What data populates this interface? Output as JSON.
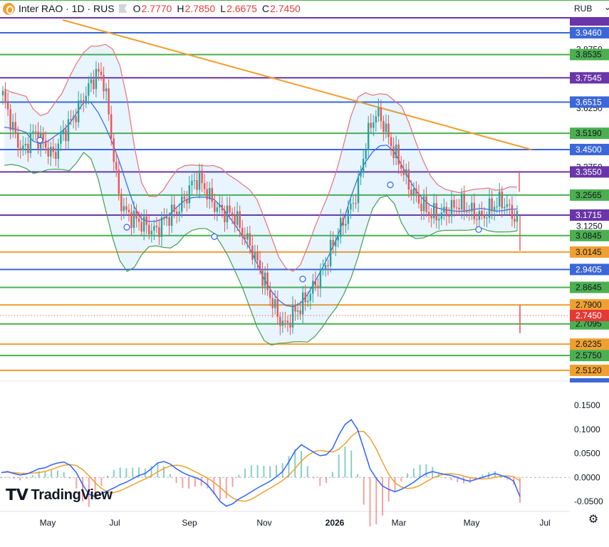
{
  "header": {
    "symbol": "Inter RAO · 1D · RUS",
    "o_label": "O",
    "o_value": "2.7770",
    "h_label": "H",
    "h_value": "2.7850",
    "l_label": "L",
    "l_value": "2.6675",
    "c_label": "C",
    "c_value": "2.7450"
  },
  "currency": "RUB",
  "brand": "TradingView",
  "chart_data": {
    "type": "line",
    "price_axis": {
      "min": 2.45,
      "max": 4.0,
      "tick_labels": [
        "3.8750",
        "3.6250",
        "3.3750",
        "3.1250"
      ]
    },
    "time_axis": {
      "labels": [
        "May",
        "Jul",
        "Sep",
        "Nov",
        "2026",
        "Mar",
        "May",
        "Jul"
      ],
      "bold": [
        "2026"
      ]
    },
    "levels": [
      {
        "price": 3.946,
        "label": "3.9460",
        "color": "#3c67d8"
      },
      {
        "price": 3.8535,
        "label": "3.8535",
        "color": "#4caf50"
      },
      {
        "price": 3.7545,
        "label": "3.7545",
        "color": "#6a35a8"
      },
      {
        "price": 3.6515,
        "label": "3.6515",
        "color": "#3c67d8"
      },
      {
        "price": 3.519,
        "label": "3.5190",
        "color": "#4caf50"
      },
      {
        "price": 3.45,
        "label": "3.4500",
        "color": "#3c67d8"
      },
      {
        "price": 3.355,
        "label": "3.3550",
        "color": "#6a35a8"
      },
      {
        "price": 3.2565,
        "label": "3.2565",
        "color": "#4caf50"
      },
      {
        "price": 3.1715,
        "label": "3.1715",
        "color": "#6a35a8"
      },
      {
        "price": 3.0845,
        "label": "3.0845",
        "color": "#4caf50"
      },
      {
        "price": 3.0145,
        "label": "3.0145",
        "color": "#f0a030"
      },
      {
        "price": 2.9405,
        "label": "2.9405",
        "color": "#3c67d8"
      },
      {
        "price": 2.8645,
        "label": "2.8645",
        "color": "#4caf50"
      },
      {
        "price": 2.79,
        "label": "2.7900",
        "color": "#f0a030"
      },
      {
        "price": 2.7095,
        "label": "2.7095",
        "color": "#4caf50"
      },
      {
        "price": 2.6235,
        "label": "2.6235",
        "color": "#f0a030"
      },
      {
        "price": 2.575,
        "label": "2.5750",
        "color": "#4caf50"
      },
      {
        "price": 2.512,
        "label": "2.5120",
        "color": "#f0a030"
      }
    ],
    "last_price": {
      "price": 2.745,
      "label": "2.7450",
      "color": "#e53935"
    },
    "trendline_color": "#f0a030",
    "price_series": [
      3.68,
      3.58,
      3.48,
      3.44,
      3.52,
      3.5,
      3.46,
      3.42,
      3.5,
      3.55,
      3.6,
      3.66,
      3.72,
      3.78,
      3.74,
      3.5,
      3.25,
      3.18,
      3.16,
      3.14,
      3.12,
      3.1,
      3.14,
      3.17,
      3.19,
      3.23,
      3.3,
      3.33,
      3.28,
      3.22,
      3.19,
      3.18,
      3.17,
      3.1,
      3.05,
      2.98,
      2.9,
      2.82,
      2.74,
      2.7,
      2.75,
      2.78,
      2.82,
      2.87,
      2.92,
      3.0,
      3.08,
      3.14,
      3.2,
      3.28,
      3.46,
      3.58,
      3.6,
      3.52,
      3.44,
      3.38,
      3.3,
      3.25,
      3.21,
      3.18,
      3.17,
      3.18,
      3.2,
      3.22,
      3.2,
      3.18,
      3.16,
      3.19,
      3.22,
      3.23,
      3.19,
      3.15
    ],
    "oscillator": {
      "ticks": [
        "0.1500",
        "0.1000",
        "0.0500",
        "0.0000",
        "-0.0500"
      ],
      "min": -0.07,
      "max": 0.17,
      "macd": [
        0.01,
        0.012,
        0.008,
        0.005,
        0.007,
        0.012,
        0.018,
        0.02,
        0.026,
        0.03,
        0.032,
        0.025,
        0.01,
        -0.015,
        -0.035,
        -0.04,
        -0.034,
        -0.028,
        -0.022,
        -0.015,
        -0.01,
        -0.003,
        0.004,
        0.008,
        0.018,
        0.03,
        0.033,
        0.028,
        0.018,
        0.01,
        0.004,
        0.0,
        -0.006,
        -0.016,
        -0.032,
        -0.05,
        -0.06,
        -0.055,
        -0.045,
        -0.038,
        -0.03,
        -0.022,
        -0.015,
        -0.008,
        0.001,
        0.012,
        0.032,
        0.055,
        0.068,
        0.06,
        0.052,
        0.045,
        0.047,
        0.06,
        0.088,
        0.11,
        0.12,
        0.1,
        0.06,
        0.018,
        -0.002,
        -0.018,
        -0.025,
        -0.03,
        -0.025,
        -0.018,
        -0.01,
        0.0,
        0.008,
        0.012,
        0.009,
        0.006,
        0.004,
        0.0,
        -0.005,
        -0.008,
        -0.004,
        0.0,
        0.004,
        0.008,
        0.004,
        0.0,
        -0.008,
        -0.04
      ],
      "macd_color": "#2962ff",
      "signal_color": "#f0a030"
    }
  }
}
